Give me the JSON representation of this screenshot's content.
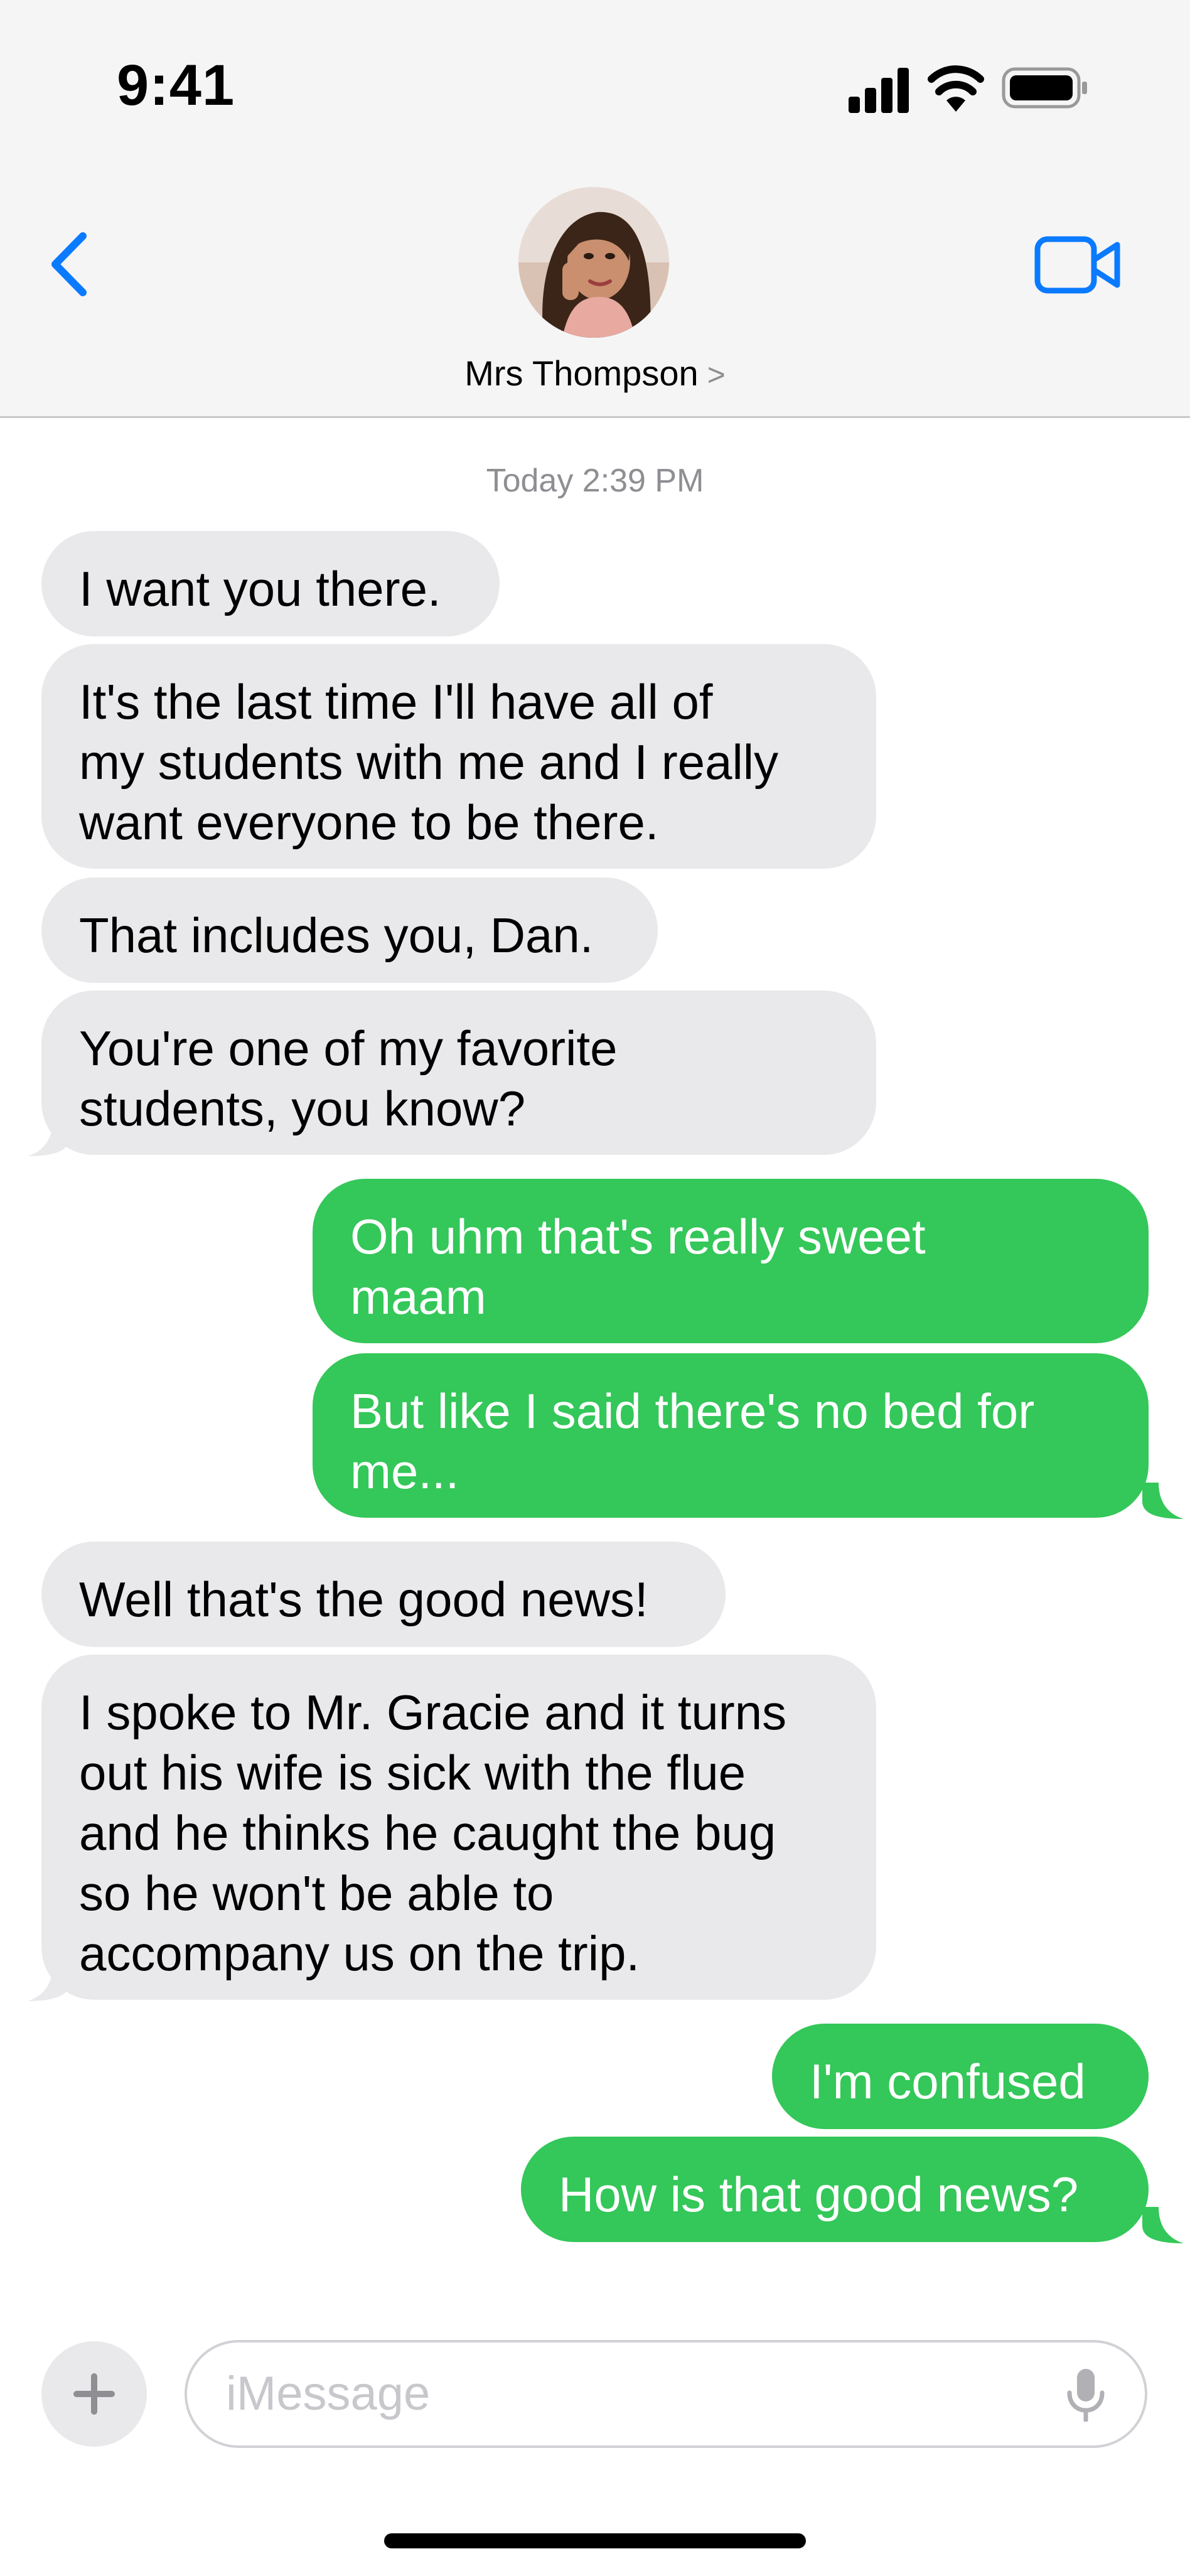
{
  "status_bar": {
    "time": "9:41",
    "signal_icon": "cellular-signal-icon",
    "wifi_icon": "wifi-icon",
    "battery_icon": "battery-icon"
  },
  "header": {
    "back_icon": "chevron-left-icon",
    "contact_name": "Mrs Thompson",
    "contact_chevron": ">",
    "video_icon": "video-camera-icon",
    "accent_color": "#0a7aff"
  },
  "conversation": {
    "timestamp": "Today 2:39 PM",
    "incoming_color": "#e9e9eb",
    "outgoing_color": "#34c759",
    "messages": [
      {
        "direction": "incoming",
        "lines": [
          "I want you there."
        ]
      },
      {
        "direction": "incoming",
        "lines": [
          "It's the last time I'll have all of",
          "my students with me and I really",
          "want everyone to be there."
        ]
      },
      {
        "direction": "incoming",
        "lines": [
          "That includes you, Dan."
        ]
      },
      {
        "direction": "incoming",
        "lines": [
          "You're one of my favorite",
          "students, you know?"
        ]
      },
      {
        "direction": "outgoing",
        "lines": [
          "Oh uhm that's really sweet",
          "maam"
        ]
      },
      {
        "direction": "outgoing",
        "lines": [
          "But like I said there's no bed for",
          "me..."
        ]
      },
      {
        "direction": "incoming",
        "lines": [
          "Well that's the good news!"
        ]
      },
      {
        "direction": "incoming",
        "lines": [
          "I spoke to Mr. Gracie and it turns",
          "out his wife is sick with the flue",
          "and he thinks he caught the bug",
          "so he won't be able to",
          "accompany us on the trip."
        ]
      },
      {
        "direction": "outgoing",
        "lines": [
          "I'm confused"
        ]
      },
      {
        "direction": "outgoing",
        "lines": [
          "How is that good news?"
        ]
      }
    ]
  },
  "composer": {
    "plus_label": "+",
    "placeholder": "iMessage",
    "mic_icon": "microphone-icon"
  }
}
